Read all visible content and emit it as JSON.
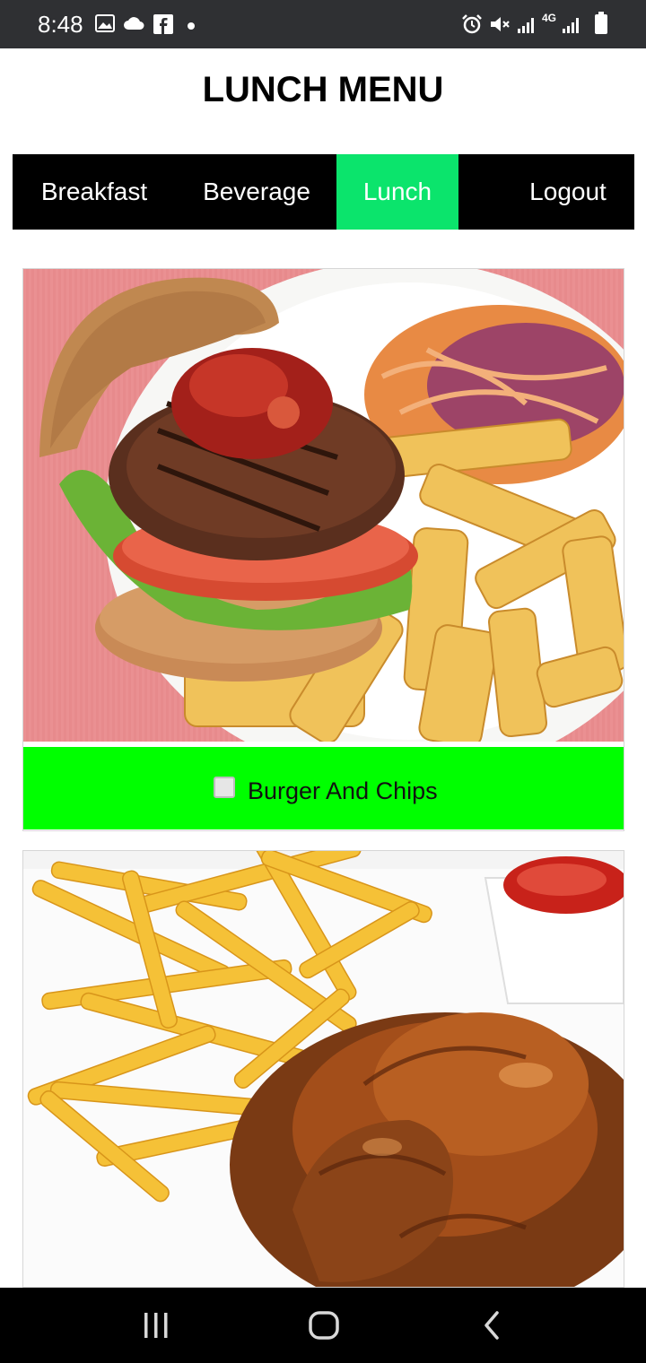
{
  "status_bar": {
    "time": "8:48",
    "left_icons": [
      "image-icon",
      "cloud-icon",
      "facebook-icon",
      "dot-icon"
    ],
    "right_icons": [
      "alarm-icon",
      "mute-icon",
      "signal-icon",
      "4g-icon",
      "signal-icon",
      "battery-icon"
    ],
    "network_label": "4G"
  },
  "header": {
    "title": "LUNCH MENU"
  },
  "nav": {
    "items": [
      {
        "label": "Breakfast",
        "active": false
      },
      {
        "label": "Beverage",
        "active": false
      },
      {
        "label": "Lunch",
        "active": true
      },
      {
        "label": "Logout",
        "active": false
      }
    ],
    "active_color": "#0be46c"
  },
  "menu_items": [
    {
      "name": "Burger And Chips",
      "checked": false,
      "caption_color": "#00ff00"
    },
    {
      "name": "",
      "checked": false
    }
  ],
  "colors": {
    "status_bar": "#2f3033",
    "nav_bg": "#000000",
    "caption_bg": "#00ff00"
  },
  "system_nav": [
    "recent-apps-icon",
    "home-icon",
    "back-icon"
  ]
}
